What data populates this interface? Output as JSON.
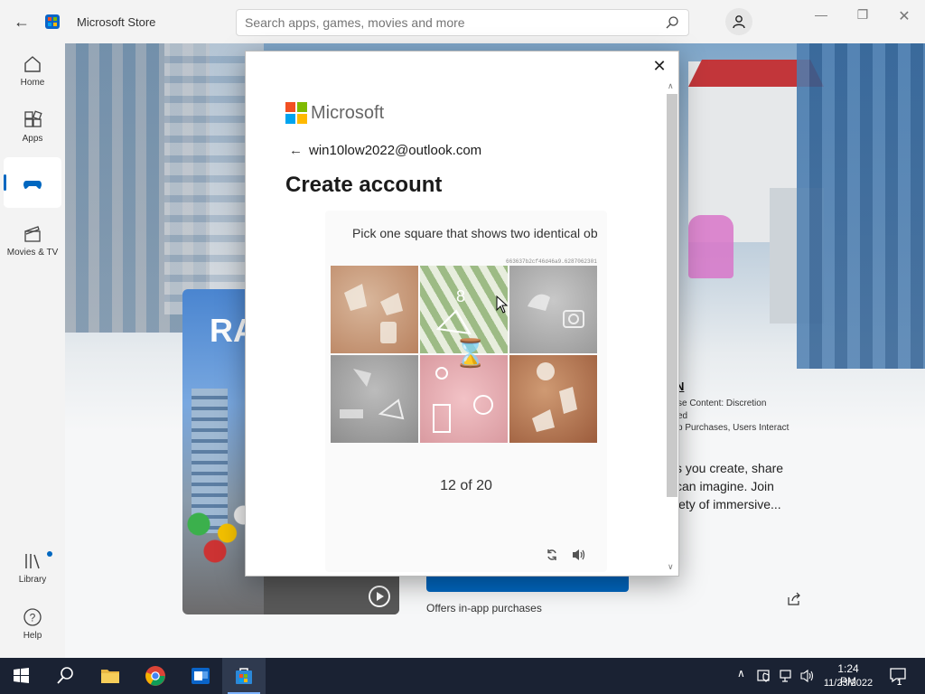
{
  "window": {
    "title": "Microsoft Store",
    "search": {
      "placeholder": "Search apps, games, movies and more"
    }
  },
  "sidebar": {
    "items": [
      {
        "label": "Home",
        "icon": "home-icon"
      },
      {
        "label": "Apps",
        "icon": "apps-icon"
      },
      {
        "label": "",
        "icon": "gaming-icon",
        "selected": true
      },
      {
        "label": "Movies & TV",
        "icon": "movies-icon"
      },
      {
        "label": "Library",
        "icon": "library-icon",
        "has_notification": true
      },
      {
        "label": "Help",
        "icon": "help-icon"
      }
    ]
  },
  "page": {
    "card_title_partial": "RA",
    "rating_title": "N",
    "rating_lines": [
      "se Content: Discretion",
      "ed",
      "p Purchases, Users Interact"
    ],
    "description_lines": [
      "s you create, share",
      "can imagine. Join",
      "iety of immersive..."
    ],
    "iap_note": "Offers in-app purchases"
  },
  "modal": {
    "brand": "Microsoft",
    "email": "win10low2022@outlook.com",
    "heading": "Create account",
    "captcha": {
      "prompt": "Pick one square that shows two identical ob",
      "session_id": "663637b2cf46d46a9.6287062301",
      "progress": "12 of 20",
      "current": 12,
      "total": 20
    }
  },
  "taskbar": {
    "pinned": [
      "start-icon",
      "search-icon",
      "file-explorer-icon",
      "chrome-icon",
      "outlook-icon",
      "microsoft-store-icon"
    ],
    "time": "1:24 PM",
    "date": "11/23/2022",
    "notification_count": "1"
  },
  "colors": {
    "accent": "#0067c0",
    "taskbar": "#1a2233",
    "ms_logo": [
      "#f25022",
      "#7fba00",
      "#00a4ef",
      "#ffb900"
    ]
  }
}
